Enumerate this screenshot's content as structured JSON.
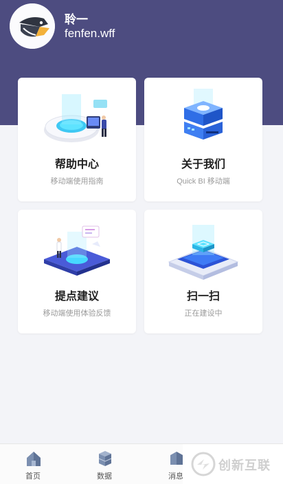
{
  "header": {
    "user_name": "聆一",
    "user_id": "fenfen.wff"
  },
  "cards": [
    {
      "title": "帮助中心",
      "subtitle": "移动端使用指南",
      "icon": "help-center-illustration"
    },
    {
      "title": "关于我们",
      "subtitle": "Quick BI 移动端",
      "icon": "about-us-illustration"
    },
    {
      "title": "提点建议",
      "subtitle": "移动端使用体验反馈",
      "icon": "feedback-illustration"
    },
    {
      "title": "扫一扫",
      "subtitle": "正在建设中",
      "icon": "scan-illustration"
    }
  ],
  "tabbar": {
    "items": [
      {
        "label": "首页",
        "icon": "home-icon"
      },
      {
        "label": "数据",
        "icon": "data-icon"
      },
      {
        "label": "消息",
        "icon": "message-icon"
      }
    ]
  },
  "watermark": {
    "text": "创新互联"
  },
  "colors": {
    "header_bg": "#4d4c80",
    "page_bg": "#f3f4f8",
    "accent_blue": "#3a7bf0",
    "accent_cyan": "#38d6f5"
  }
}
